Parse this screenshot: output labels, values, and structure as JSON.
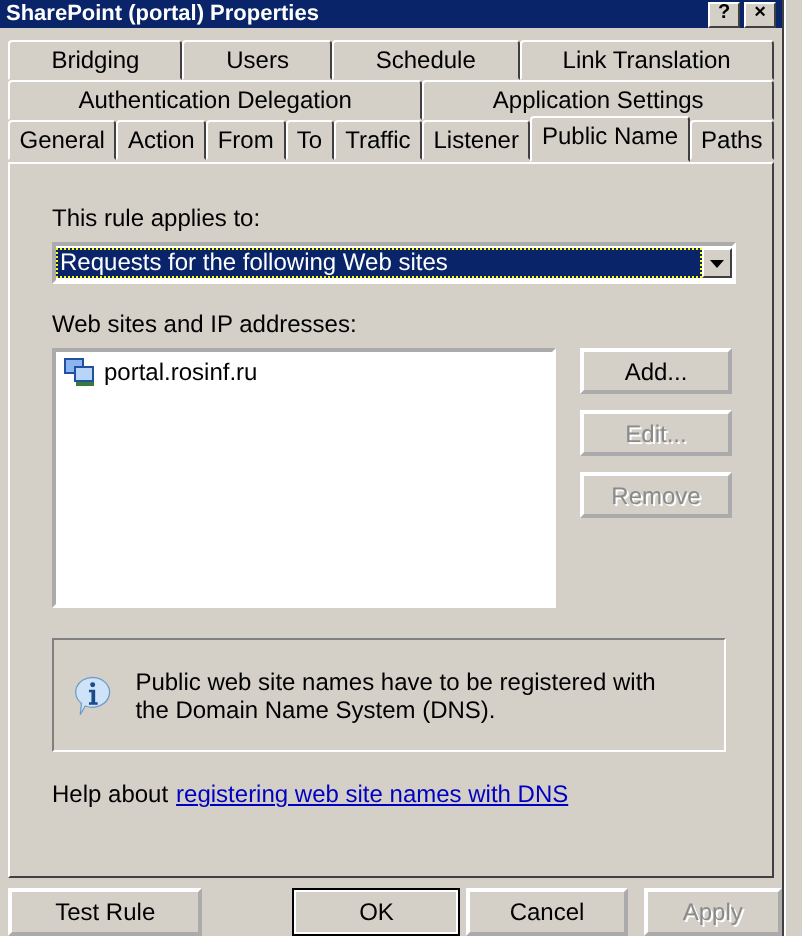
{
  "window": {
    "title": "SharePoint (portal) Properties"
  },
  "title_buttons": [
    {
      "label": "?"
    },
    {
      "label": "×"
    }
  ],
  "tab_rows": [
    {
      "tabs": [
        {
          "label": "Bridging",
          "selected": false
        },
        {
          "label": "Users",
          "selected": false
        },
        {
          "label": "Schedule",
          "selected": false
        },
        {
          "label": "Link Translation",
          "selected": false
        }
      ]
    },
    {
      "tabs": [
        {
          "label": "Authentication Delegation",
          "selected": false
        },
        {
          "label": "Application Settings",
          "selected": false
        }
      ]
    },
    {
      "tabs": [
        {
          "label": "General",
          "selected": false
        },
        {
          "label": "Action",
          "selected": false
        },
        {
          "label": "From",
          "selected": false
        },
        {
          "label": "To",
          "selected": false
        },
        {
          "label": "Traffic",
          "selected": false
        },
        {
          "label": "Listener",
          "selected": false
        },
        {
          "label": "Public Name",
          "selected": true
        },
        {
          "label": "Paths",
          "selected": false
        }
      ]
    }
  ],
  "applies_label": "This rule applies to:",
  "applies_dropdown": {
    "value": "Requests for the following Web sites"
  },
  "sites_label": "Web sites and IP addresses:",
  "sites": [
    {
      "name": "portal.rosinf.ru"
    }
  ],
  "side_buttons": [
    {
      "label": "Add...",
      "disabled": false
    },
    {
      "label": "Edit...",
      "disabled": true
    },
    {
      "label": "Remove",
      "disabled": true
    }
  ],
  "info": {
    "text": "Public web site names have to be registered with the Domain Name System (DNS)."
  },
  "help": {
    "prefix": "Help about",
    "link": "registering web site names with DNS"
  },
  "bottom_buttons": [
    {
      "label": "Test Rule",
      "disabled": false
    },
    {
      "label": "OK",
      "disabled": false
    },
    {
      "label": "Cancel",
      "disabled": false
    },
    {
      "label": "Apply",
      "disabled": true
    }
  ]
}
